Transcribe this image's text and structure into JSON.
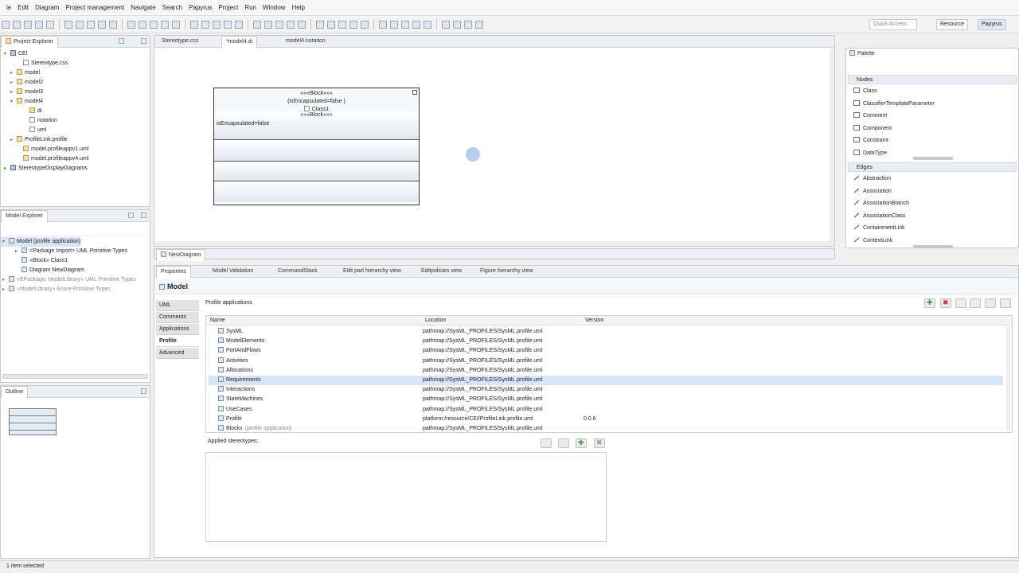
{
  "menu": [
    "le",
    "Edit",
    "Diagram",
    "Project management",
    "Navigate",
    "Search",
    "Papyrus",
    "Project",
    "Run",
    "Window",
    "Help"
  ],
  "quick_access_placeholder": "Quick Access",
  "perspectives": [
    "Resource",
    "Papyrus"
  ],
  "project_explorer": {
    "title": "Project Explorer",
    "items": [
      {
        "label": "CEl",
        "indent": 0,
        "twisty": "▾",
        "icon": "prj"
      },
      {
        "label": "Stereotype.css",
        "indent": 2,
        "twisty": "",
        "icon": "file"
      },
      {
        "label": "model",
        "indent": 1,
        "twisty": "▸",
        "icon": "pkg"
      },
      {
        "label": "model2",
        "indent": 1,
        "twisty": "▸",
        "icon": "pkg"
      },
      {
        "label": "model3",
        "indent": 1,
        "twisty": "▸",
        "icon": "pkg"
      },
      {
        "label": "model4",
        "indent": 1,
        "twisty": "▾",
        "icon": "pkg"
      },
      {
        "label": "di",
        "indent": 3,
        "twisty": "",
        "icon": "pkg"
      },
      {
        "label": "notation",
        "indent": 3,
        "twisty": "",
        "icon": "file"
      },
      {
        "label": "uml",
        "indent": 3,
        "twisty": "",
        "icon": "file"
      },
      {
        "label": "ProfileLink.profile",
        "indent": 1,
        "twisty": "▸",
        "icon": "pkg"
      },
      {
        "label": "model.profileappv1.uml",
        "indent": 2,
        "twisty": "",
        "icon": "pkg"
      },
      {
        "label": "model.profileappv4.uml",
        "indent": 2,
        "twisty": "",
        "icon": "pkg"
      },
      {
        "label": "StereotypeDisplayDiagrams",
        "indent": 0,
        "twisty": "▸",
        "icon": "prj"
      }
    ]
  },
  "model_explorer": {
    "title": "Model Explorer",
    "items": [
      {
        "label": "Model (profile application)",
        "indent": 0,
        "twisty": "▾",
        "grey": false,
        "selected": true
      },
      {
        "label": "<Package Import> UML Primitive Types",
        "indent": 2,
        "twisty": "▸",
        "grey": false,
        "selected": false
      },
      {
        "label": "«Block» Class1",
        "indent": 2,
        "twisty": "",
        "grey": false,
        "selected": false
      },
      {
        "label": "Diagram NewDiagram",
        "indent": 2,
        "twisty": "",
        "grey": false,
        "selected": false
      },
      {
        "label": "«EPackage, ModelLibrary» UML Primitive Types",
        "indent": 0,
        "twisty": "▸",
        "grey": true,
        "selected": false
      },
      {
        "label": "«ModelLibrary» Ecore Primitive Types",
        "indent": 0,
        "twisty": "▸",
        "grey": true,
        "selected": false
      }
    ]
  },
  "outline": {
    "title": "Outline"
  },
  "editor_tabs": [
    "Stereotype.css",
    "*model4.di",
    "model4.notation"
  ],
  "diagram_tab": "NewDiagram",
  "block": {
    "stereotype": "«««Block»»»",
    "property": "{isEncapsulated=false }",
    "name": "Class1",
    "compartment_header": "«««Block»»»",
    "compartment_text": "isEncapsulated=false"
  },
  "palette": {
    "title": "Palette",
    "nodes_header": "Nodes",
    "nodes": [
      "Class",
      "ClassifierTemplateParameter",
      "Comment",
      "Component",
      "Constraint",
      "DataType"
    ],
    "edges_header": "Edges",
    "edges": [
      "Abstraction",
      "Association",
      "AssociationBranch",
      "AssociationClass",
      "ContainmentLink",
      "ContextLink"
    ]
  },
  "bottom_tabs": [
    "Properties",
    "Model Validation",
    "CommandStack",
    "Edit part hierarchy view",
    "Editpolicies view",
    "Figure hierarchy view"
  ],
  "properties": {
    "title": "Model",
    "side_tabs": [
      "UML",
      "Comments",
      "Applications",
      "Profile",
      "Advanced"
    ],
    "active_side_tab": 3,
    "section_label": "Profile applications",
    "columns": [
      "Name",
      "Location",
      "Version"
    ],
    "rows": [
      {
        "name": "SysML",
        "location": "pathmap://SysML_PROFILES/SysML.profile.uml",
        "version": "",
        "suffix": ""
      },
      {
        "name": "ModelElements",
        "location": "pathmap://SysML_PROFILES/SysML.profile.uml",
        "version": "",
        "suffix": ""
      },
      {
        "name": "PortAndFlows",
        "location": "pathmap://SysML_PROFILES/SysML.profile.uml",
        "version": "",
        "suffix": ""
      },
      {
        "name": "Activities",
        "location": "pathmap://SysML_PROFILES/SysML.profile.uml",
        "version": "",
        "suffix": ""
      },
      {
        "name": "Allocations",
        "location": "pathmap://SysML_PROFILES/SysML.profile.uml",
        "version": "",
        "suffix": ""
      },
      {
        "name": "Requirements",
        "location": "pathmap://SysML_PROFILES/SysML.profile.uml",
        "version": "",
        "suffix": ""
      },
      {
        "name": "Interactions",
        "location": "pathmap://SysML_PROFILES/SysML.profile.uml",
        "version": "",
        "suffix": ""
      },
      {
        "name": "StateMachines",
        "location": "pathmap://SysML_PROFILES/SysML.profile.uml",
        "version": "",
        "suffix": ""
      },
      {
        "name": "UseCases",
        "location": "pathmap://SysML_PROFILES/SysML.profile.uml",
        "version": "",
        "suffix": ""
      },
      {
        "name": "Profile",
        "location": "platform:/resource/CEl/ProfileLink.profile.uml",
        "version": "0.0.6",
        "suffix": ""
      },
      {
        "name": "Blocks",
        "location": "pathmap://SysML_PROFILES/SysML.profile.uml",
        "version": "",
        "suffix": "(profile application)"
      }
    ],
    "applied_label": "Applied stereotypes:"
  },
  "status_text": "1 item selected",
  "colors": {
    "accent_blue": "#d6e6f7",
    "add_green": "#3a9a3a",
    "remove_red": "#cc2a2a"
  }
}
